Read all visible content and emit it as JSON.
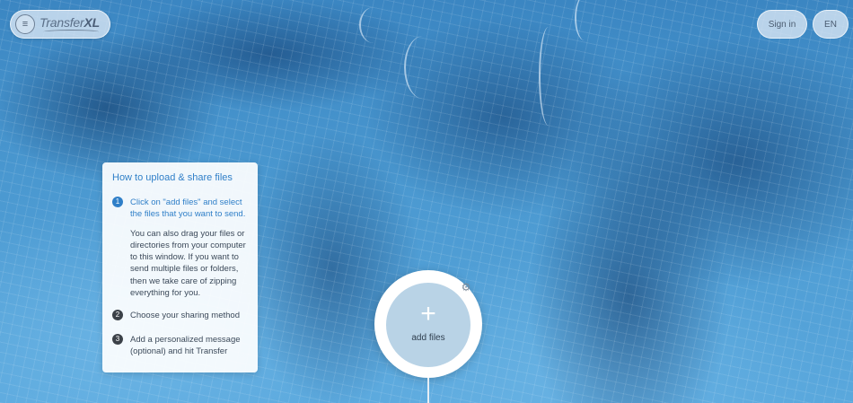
{
  "header": {
    "brand_regular": "Transfer",
    "brand_bold": "XL",
    "sign_in_label": "Sign in",
    "language_label": "EN"
  },
  "instructions": {
    "title": "How to upload & share files",
    "steps": [
      {
        "number": "1",
        "text": "Click on \"add files\" and select the files that you want to send.",
        "detail": "You can also drag your files or directories from your computer to this window. If you want to send multiple files or folders, then we take care of zipping everything for you."
      },
      {
        "number": "2",
        "text": "Choose your sharing method"
      },
      {
        "number": "3",
        "text": "Add a personalized message (optional) and hit Transfer"
      }
    ]
  },
  "uploader": {
    "plus_glyph": "+",
    "add_files_label": "add files",
    "settings_glyph": "⚙"
  },
  "colors": {
    "accent": "#2f7fc8",
    "pool": "#3b86c2"
  }
}
